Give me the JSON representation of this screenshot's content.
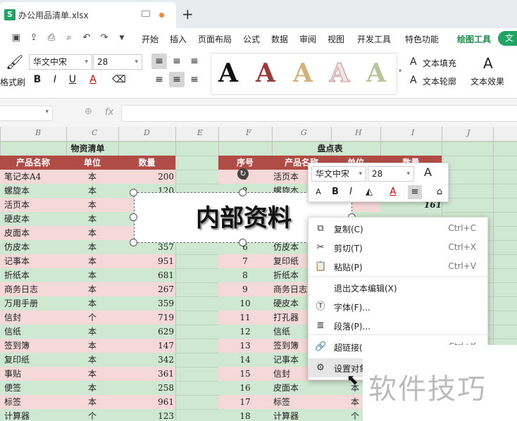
{
  "file_tab": {
    "icon": "S",
    "name": "办公用品清单.xlsx"
  },
  "menu": {
    "items": [
      "开始",
      "插入",
      "页面布局",
      "公式",
      "数据",
      "审阅",
      "视图",
      "开发工具",
      "特色功能"
    ],
    "draw_tools": "绘图工具",
    "text_tools": "文"
  },
  "ribbon": {
    "format_painter": "格式刷",
    "font": "华文中宋",
    "size": "28",
    "bold": "B",
    "italic": "I",
    "underline": "U",
    "fontcolor": "A",
    "wordart_letter": "A",
    "text_fill": "文本填充",
    "text_outline": "文本轮廓",
    "text_effect": "文本效果"
  },
  "formula": {
    "fx": "fx"
  },
  "columns": [
    "B",
    "C",
    "D",
    "E",
    "F",
    "G",
    "H",
    "I",
    "J"
  ],
  "left_table": {
    "title": "物资清单",
    "headers": [
      "产品名称",
      "单位",
      "数量"
    ],
    "rows": [
      [
        "笔记本A4",
        "本",
        "200"
      ],
      [
        "螺旋本",
        "本",
        "120"
      ],
      [
        "活页本",
        "本",
        ""
      ],
      [
        "硬皮本",
        "本",
        ""
      ],
      [
        "皮面本",
        "本",
        ""
      ],
      [
        "仿皮本",
        "本",
        "357"
      ],
      [
        "记事本",
        "本",
        "951"
      ],
      [
        "折纸本",
        "本",
        "681"
      ],
      [
        "商务日志",
        "本",
        "267"
      ],
      [
        "万用手册",
        "本",
        "359"
      ],
      [
        "信封",
        "个",
        "719"
      ],
      [
        "信纸",
        "本",
        "629"
      ],
      [
        "签到簿",
        "本",
        "147"
      ],
      [
        "复印纸",
        "本",
        "342"
      ],
      [
        "事贴",
        "本",
        "361"
      ],
      [
        "便签",
        "本",
        "258"
      ],
      [
        "标签",
        "本",
        "961"
      ],
      [
        "计算器",
        "个",
        "123"
      ]
    ]
  },
  "right_table": {
    "title": "盘点表",
    "headers": [
      "序号",
      "产品名称",
      "单位",
      "数量"
    ],
    "rows": [
      [
        "1",
        "活页本"
      ],
      [
        "2",
        "螺旋本"
      ],
      [
        "",
        "",
        ""
      ],
      [
        "",
        "",
        ""
      ],
      [
        "",
        "",
        ""
      ],
      [
        "6",
        "仿皮本"
      ],
      [
        "7",
        "复印纸"
      ],
      [
        "8",
        "折纸本"
      ],
      [
        "9",
        "商务日志"
      ],
      [
        "10",
        "硬皮本"
      ],
      [
        "11",
        "打孔器"
      ],
      [
        "12",
        "信纸"
      ],
      [
        "13",
        "签到簿"
      ],
      [
        "14",
        "记事本"
      ],
      [
        "15",
        "信封"
      ],
      [
        "16",
        "皮面本",
        "本"
      ],
      [
        "17",
        "标签",
        "本"
      ],
      [
        "18",
        "计算器",
        "个"
      ]
    ],
    "partial_qty": "161"
  },
  "textbox": {
    "text": "内部资料"
  },
  "mini_toolbar": {
    "font": "华文中宋",
    "size": "28",
    "grow": "A",
    "shrink": "A",
    "bold": "B",
    "italic": "I",
    "color": "A"
  },
  "context_menu": [
    {
      "icon": "copy-icon",
      "label": "复制(C)",
      "shortcut": "Ctrl+C"
    },
    {
      "icon": "cut-icon",
      "label": "剪切(T)",
      "shortcut": "Ctrl+X"
    },
    {
      "icon": "paste-icon",
      "label": "粘贴(P)",
      "shortcut": "Ctrl+V"
    },
    {
      "icon": "",
      "label": "退出文本编辑(X)",
      "shortcut": ""
    },
    {
      "icon": "font-icon",
      "label": "字体(F)...",
      "shortcut": ""
    },
    {
      "icon": "paragraph-icon",
      "label": "段落(P)...",
      "shortcut": ""
    },
    {
      "icon": "link-icon",
      "label": "超链接(",
      "shortcut": "Ctrl+K"
    },
    {
      "icon": "format-object-icon",
      "label": "设置对象",
      "shortcut": ""
    }
  ],
  "watermark": "软件技巧"
}
